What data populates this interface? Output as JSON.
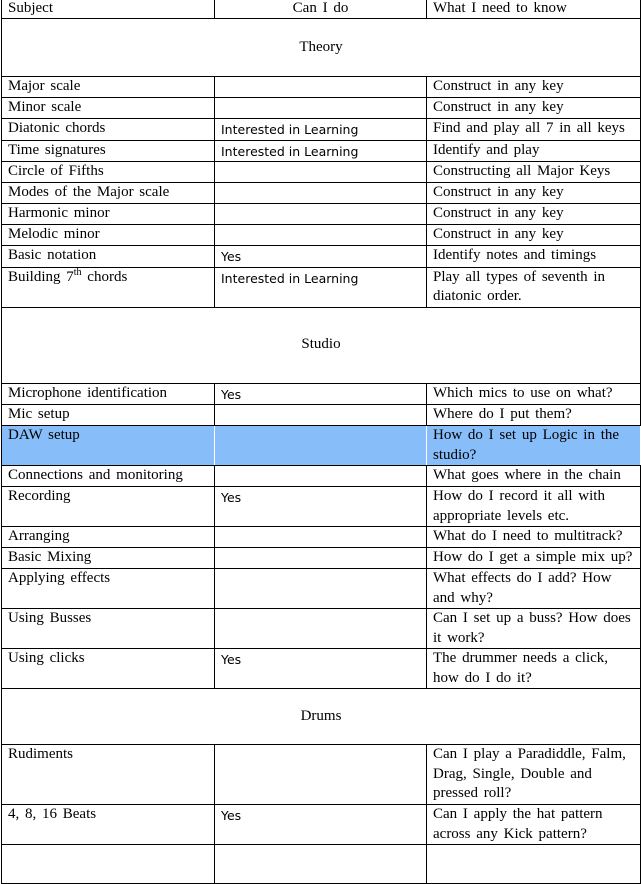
{
  "table": {
    "headers": {
      "subject": "Subject",
      "can_i_do": "Can I do",
      "need_to_know": "What I need to know"
    },
    "highlight_color": "#87bdf8",
    "sections": [
      {
        "title": "Theory",
        "rows": [
          {
            "subject": "Major scale",
            "can": "",
            "know": "Construct  in  any key"
          },
          {
            "subject": "Minor  scale",
            "can": "",
            "know": "Construct  in  any key"
          },
          {
            "subject": "Diatonic  chords",
            "can": "Interested in Learning",
            "know": "Find and play all 7 in all keys"
          },
          {
            "subject": "Time  signatures",
            "can": "Interested in Learning",
            "know": "Identify  and play"
          },
          {
            "subject": "Circle  of Fifths",
            "can": "",
            "know": "Constructing  all Major Keys"
          },
          {
            "subject": "Modes of the Major scale",
            "can": "",
            "know": "Construct  in  any key"
          },
          {
            "subject": "Harmonic  minor",
            "can": "",
            "know": "Construct  in  any key"
          },
          {
            "subject": "Melodic  minor",
            "can": "",
            "know": "Construct  in  any key"
          },
          {
            "subject": "Basic notation",
            "can": "Yes",
            "know": "Identify  notes and timings"
          },
          {
            "subject_pre": "Building  7",
            "subject_sup": "th",
            "subject_post": " chords",
            "can": "Interested in Learning",
            "know": "Play all types of seventh in diatonic  order."
          }
        ]
      },
      {
        "title": "Studio",
        "rows": [
          {
            "subject": "Microphone  identification",
            "can": "Yes",
            "know": "Which  mics to use on what?"
          },
          {
            "subject": "Mic setup",
            "can": "",
            "know": "Where  do I put them?"
          },
          {
            "subject": "DAW  setup",
            "can": "",
            "know": "How do I set up Logic  in the studio?",
            "highlighted": true
          },
          {
            "subject": "Connections  and monitoring",
            "can": "",
            "know": "What goes where in the chain"
          },
          {
            "subject": "Recording",
            "can": "Yes",
            "know": "How do I record it all  with appropriate  levels  etc."
          },
          {
            "subject": "Arranging",
            "can": "",
            "know": "What do I need to multitrack?"
          },
          {
            "subject": "Basic Mixing",
            "can": "",
            "know": "How do I get a simple  mix  up?"
          },
          {
            "subject": "Applying  effects",
            "can": "",
            "know": "What effects  do I add? How and why?"
          },
          {
            "subject": "Using  Busses",
            "can": "",
            "know": "Can I set up a buss? How does it  work?"
          },
          {
            "subject": "Using  clicks",
            "can": "Yes",
            "know": "The  drummer  needs a click, how  do I do it?"
          }
        ]
      },
      {
        "title": "Drums",
        "rows": [
          {
            "subject": "Rudiments",
            "can": "",
            "know": "Can I play a Paradiddle,  Falm, Drag, Single,  Double  and pressed roll?"
          },
          {
            "subject": "4, 8, 16 Beats",
            "can": "Yes",
            "know": "Can I apply the hat pattern across any Kick pattern?"
          }
        ]
      }
    ]
  }
}
